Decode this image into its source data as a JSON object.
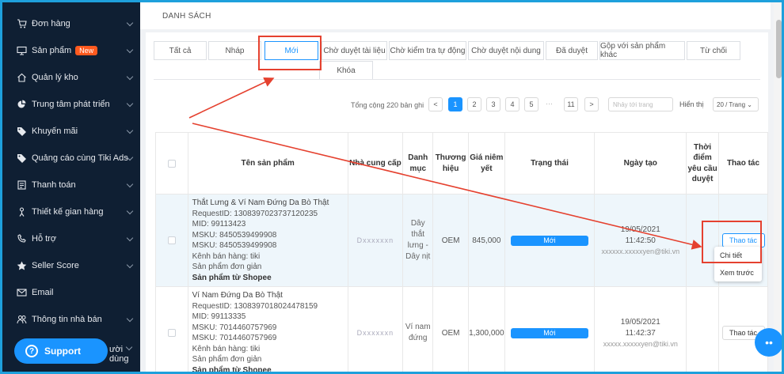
{
  "sidebar": {
    "items": [
      {
        "label": "Đơn hàng",
        "icon": "cart-icon"
      },
      {
        "label": "Sản phẩm",
        "icon": "monitor-icon",
        "badge": "New"
      },
      {
        "label": "Quản lý kho",
        "icon": "house-icon"
      },
      {
        "label": "Trung tâm phát triển",
        "icon": "pie-chart-icon"
      },
      {
        "label": "Khuyến mãi",
        "icon": "tag-icon"
      },
      {
        "label": "Quảng cáo cùng Tiki Ads",
        "icon": "tag-icon"
      },
      {
        "label": "Thanh toán",
        "icon": "receipt-icon"
      },
      {
        "label": "Thiết kế gian hàng",
        "icon": "person-icon"
      },
      {
        "label": "Hỗ trợ",
        "icon": "phone-icon"
      },
      {
        "label": "Seller Score",
        "icon": "star-icon"
      },
      {
        "label": "Email",
        "icon": "mail-icon"
      },
      {
        "label": "Thông tin nhà bán",
        "icon": "people-icon"
      }
    ],
    "support_label": "Support",
    "hidden_item_tail": "ười dùng"
  },
  "header": {
    "title": "DANH SÁCH"
  },
  "tabs": [
    {
      "label": "Tất cả"
    },
    {
      "label": "Nháp"
    },
    {
      "label": "Mới"
    },
    {
      "label": "Chờ duyệt tài liệu"
    },
    {
      "label": "Chờ kiểm tra tự động"
    },
    {
      "label": "Chờ duyệt nội dung"
    },
    {
      "label": "Đã duyệt"
    },
    {
      "label": "Gộp với sản phẩm khác"
    },
    {
      "label": "Từ chối"
    },
    {
      "label": "Khóa"
    }
  ],
  "active_tab": "Mới",
  "pagination": {
    "total_text": "Tổng cộng 220 bản ghi",
    "prev": "<",
    "pages": [
      "1",
      "2",
      "3",
      "4",
      "5"
    ],
    "ellipsis": "···",
    "last_page": "11",
    "next": ">",
    "current_page": "1",
    "jump_placeholder": "Nhảy tới trang",
    "per_page_label": "Hiển thị",
    "per_page_value": "20 / Trang ⌄"
  },
  "table": {
    "columns": [
      "Tên sản phẩm",
      "Nhà cung cấp",
      "Danh mục",
      "Thương hiệu",
      "Giá niêm yết",
      "Trạng thái",
      "Ngày tạo",
      "Thời điểm yêu cầu duyệt",
      "Thao tác"
    ],
    "rows": [
      {
        "name": "Thắt Lưng & Ví Nam Đứng Da Bò Thật",
        "request_id": "RequestID: 1308397023737120235",
        "mid": "MID: 99113423",
        "msku1": "MSKU: 8450539499908",
        "msku2": "MSKU: 8450539499908",
        "channel": "Kênh bán hàng: tiki",
        "type": "Sản phẩm đơn giản",
        "source": "Sản phẩm từ Shopee",
        "supplier": "Dxxxxxxn",
        "category": "Dây thắt lưng - Dây nịt",
        "brand": "OEM",
        "price": "845,000",
        "status": "Mới",
        "date": "19/05/2021",
        "time": "11:42:50",
        "creator": "xxxxxx.xxxxxyen@tiki.vn",
        "review_time": "",
        "action": "Thao tác"
      },
      {
        "name": "Ví Nam Đứng Da Bò Thật",
        "request_id": "RequestID: 1308397018024478159",
        "mid": "MID: 99113335",
        "msku1": "MSKU: 7014460757969",
        "msku2": "MSKU: 7014460757969",
        "channel": "Kênh bán hàng: tiki",
        "type": "Sản phẩm đơn giản",
        "source": "Sản phẩm từ Shopee",
        "supplier": "Dxxxxxxn",
        "category": "Ví nam đứng",
        "brand": "OEM",
        "price": "1,300,000",
        "status": "Mới",
        "date": "19/05/2021",
        "time": "11:42:37",
        "creator": "xxxxx.xxxxxyen@tiki.vn",
        "review_time": "",
        "action": "Thao tác"
      }
    ]
  },
  "action_menu": {
    "items": [
      "Chi tiết",
      "Xem trước"
    ]
  },
  "colors": {
    "accent": "#1a94ff",
    "sidebar_bg": "#0f1f33",
    "annotation_red": "#e5412f",
    "frame": "#1ea0dc",
    "badge_new": "#ff5a1f"
  }
}
